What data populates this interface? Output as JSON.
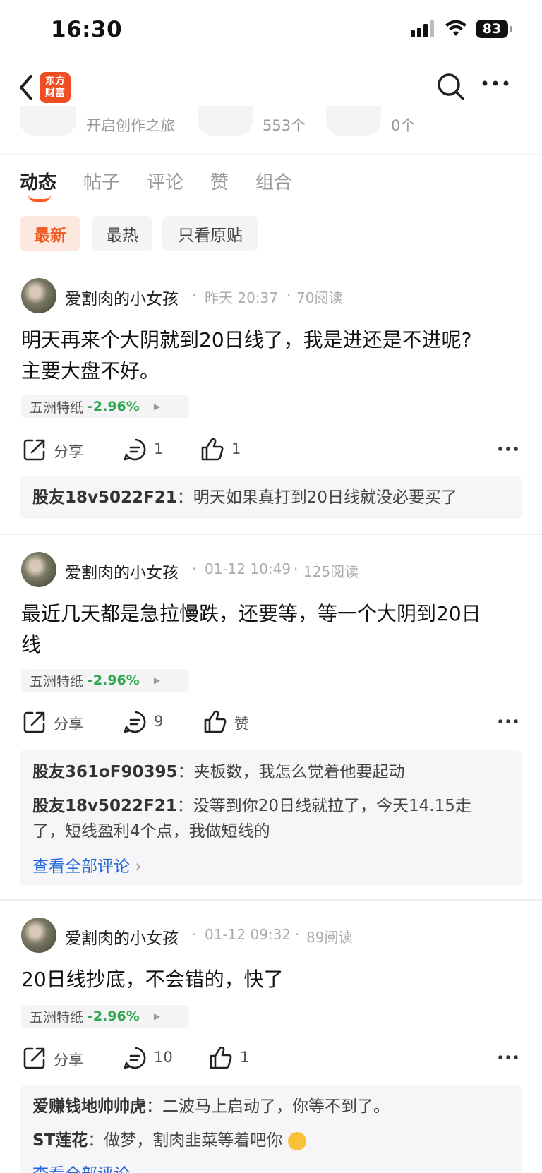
{
  "status_bar": {
    "time": "16:30",
    "battery": "83"
  },
  "nav": {
    "logo_line1": "东方",
    "logo_line2": "财富"
  },
  "stats": {
    "create_text": "开启创作之旅",
    "fans_count": "553个",
    "zero_count": "0个"
  },
  "tabs": [
    {
      "label": "动态"
    },
    {
      "label": "帖子"
    },
    {
      "label": "评论"
    },
    {
      "label": "赞"
    },
    {
      "label": "组合"
    }
  ],
  "filters": [
    {
      "label": "最新"
    },
    {
      "label": "最热"
    },
    {
      "label": "只看原贴"
    }
  ],
  "posts": [
    {
      "author": "爱割肉的小女孩",
      "time": "昨天 20:37",
      "reads": "70阅读",
      "line1": "明天再来个大阴就到20日线了，我是进还是不进呢?",
      "line2": "主要大盘不好。",
      "stock_name": "五洲特纸",
      "stock_change": "-2.96%",
      "share_label": "分享",
      "comment_count": "1",
      "like_label": "1",
      "comments": [
        {
          "user": "股友18v5022F21",
          "text": "明天如果真打到20日线就没必要买了"
        }
      ]
    },
    {
      "author": "爱割肉的小女孩",
      "time": "01-12 10:49",
      "reads": "125阅读",
      "line1": "最近几天都是急拉慢跌，还要等，等一个大阴到20日",
      "line2": "线",
      "stock_name": "五洲特纸",
      "stock_change": "-2.96%",
      "share_label": "分享",
      "comment_count": "9",
      "like_label": "赞",
      "comments": [
        {
          "user": "股友361oF90395",
          "text": "夹板数，我怎么觉着他要起动"
        },
        {
          "user": "股友18v5022F21",
          "text": "没等到你20日线就拉了，今天14.15走",
          "text2": "了，短线盈利4个点，我做短线的"
        }
      ],
      "see_all": "查看全部评论"
    },
    {
      "author": "爱割肉的小女孩",
      "time": "01-12 09:32",
      "reads": "89阅读",
      "line1": "20日线抄底，不会错的，快了",
      "stock_name": "五洲特纸",
      "stock_change": "-2.96%",
      "share_label": "分享",
      "comment_count": "10",
      "like_label": "1",
      "comments": [
        {
          "user": "爱赚钱地帅帅虎",
          "text": "二波马上启动了，你等不到了。"
        },
        {
          "user": "ST莲花",
          "text": "做梦，割肉韭菜等着吧你"
        }
      ],
      "see_all": "查看全部评论"
    }
  ]
}
